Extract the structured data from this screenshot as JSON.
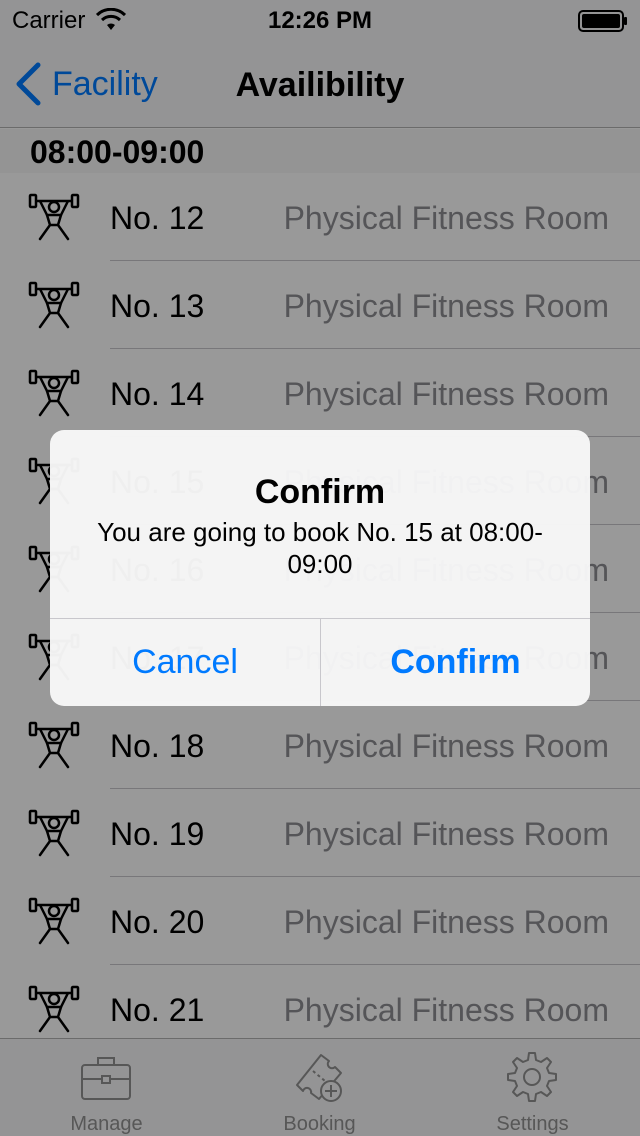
{
  "status_bar": {
    "carrier": "Carrier",
    "time": "12:26 PM"
  },
  "nav": {
    "back_label": "Facility",
    "title": "Availibility"
  },
  "section": {
    "header": "08:00-09:00"
  },
  "rows": [
    {
      "number": "No. 12",
      "room": "Physical Fitness Room",
      "icon": "weightlifter-icon"
    },
    {
      "number": "No. 13",
      "room": "Physical Fitness Room",
      "icon": "weightlifter-icon"
    },
    {
      "number": "No. 14",
      "room": "Physical Fitness Room",
      "icon": "weightlifter-icon"
    },
    {
      "number": "No. 15",
      "room": "Physical Fitness Room",
      "icon": "weightlifter-icon"
    },
    {
      "number": "No. 16",
      "room": "Physical Fitness Room",
      "icon": "weightlifter-icon"
    },
    {
      "number": "No. 17",
      "room": "Physical Fitness Room",
      "icon": "weightlifter-icon"
    },
    {
      "number": "No. 18",
      "room": "Physical Fitness Room",
      "icon": "weightlifter-icon"
    },
    {
      "number": "No. 19",
      "room": "Physical Fitness Room",
      "icon": "weightlifter-icon"
    },
    {
      "number": "No. 20",
      "room": "Physical Fitness Room",
      "icon": "weightlifter-icon"
    },
    {
      "number": "No. 21",
      "room": "Physical Fitness Room",
      "icon": "weightlifter-icon"
    }
  ],
  "tab_bar": {
    "tabs": [
      {
        "label": "Manage",
        "icon": "briefcase-icon"
      },
      {
        "label": "Booking",
        "icon": "ticket-add-icon"
      },
      {
        "label": "Settings",
        "icon": "gear-icon"
      }
    ]
  },
  "alert": {
    "title": "Confirm",
    "message": "You are going to book No. 15 at 08:00-09:00",
    "cancel_label": "Cancel",
    "confirm_label": "Confirm"
  },
  "colors": {
    "accent": "#007aff",
    "secondary_text": "#8e8e93",
    "tab_inactive": "#929292"
  }
}
